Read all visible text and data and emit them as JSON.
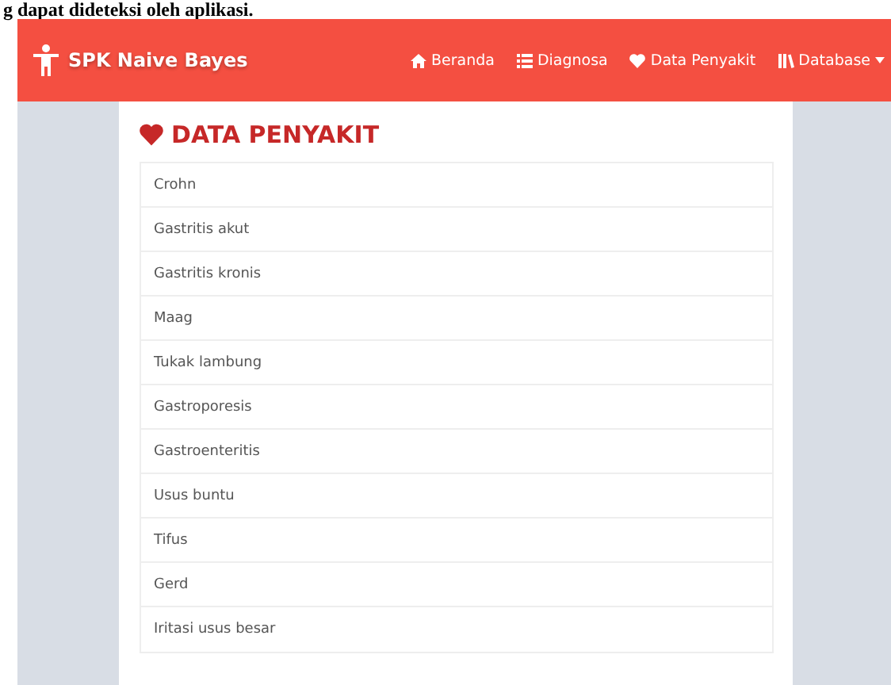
{
  "document_text": "g dapat dideteksi oleh aplikasi.",
  "navbar": {
    "brand": "SPK Naive Bayes",
    "items": [
      {
        "label": "Beranda",
        "kind": "home",
        "dropdown": false
      },
      {
        "label": "Diagnosa",
        "kind": "list",
        "dropdown": false
      },
      {
        "label": "Data Penyakit",
        "kind": "heart",
        "dropdown": false
      },
      {
        "label": "Database",
        "kind": "books",
        "dropdown": true
      }
    ]
  },
  "panel": {
    "title": "DATA PENYAKIT",
    "items": [
      "Crohn",
      "Gastritis akut",
      "Gastritis kronis",
      "Maag",
      "Tukak lambung",
      "Gastroporesis",
      "Gastroenteritis",
      "Usus buntu",
      "Tifus",
      "Gerd",
      "Iritasi usus besar"
    ]
  }
}
